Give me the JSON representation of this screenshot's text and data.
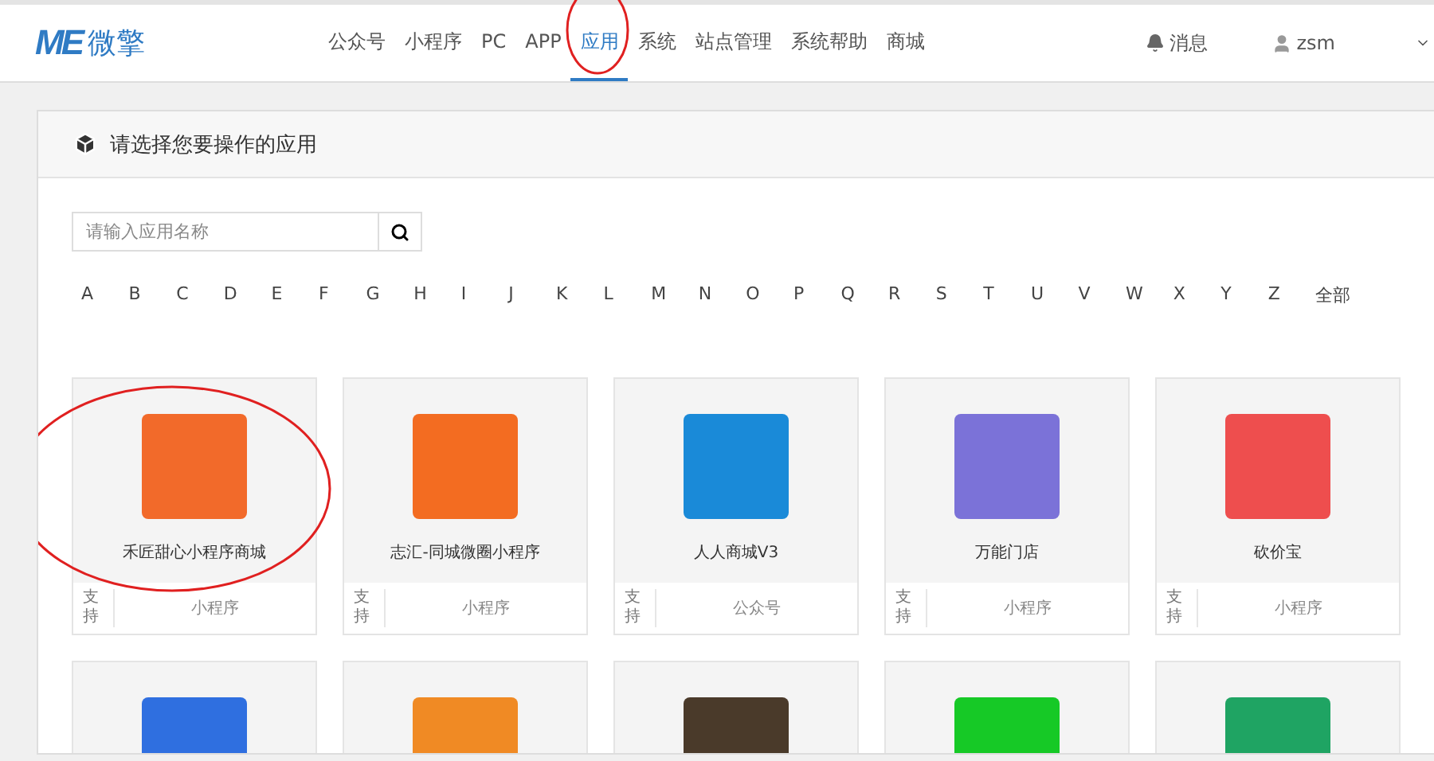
{
  "logo": {
    "mark": "ME",
    "name": "微擎"
  },
  "nav": [
    {
      "label": "公众号",
      "selected": false,
      "circled": false
    },
    {
      "label": "小程序",
      "selected": false,
      "circled": false
    },
    {
      "label": "PC",
      "selected": false,
      "circled": false
    },
    {
      "label": "APP",
      "selected": false,
      "circled": false
    },
    {
      "label": "应用",
      "selected": true,
      "circled": true
    },
    {
      "label": "系统",
      "selected": false,
      "circled": false
    },
    {
      "label": "站点管理",
      "selected": false,
      "circled": false
    },
    {
      "label": "系统帮助",
      "selected": false,
      "circled": false
    },
    {
      "label": "商城",
      "selected": false,
      "circled": false
    }
  ],
  "messages": "消息",
  "user": "zsm",
  "panel": {
    "title": "请选择您要操作的应用",
    "search": {
      "placeholder": "请输入应用名称"
    },
    "letters": [
      "A",
      "B",
      "C",
      "D",
      "E",
      "F",
      "G",
      "H",
      "I",
      "J",
      "K",
      "L",
      "M",
      "N",
      "O",
      "P",
      "Q",
      "R",
      "S",
      "T",
      "U",
      "V",
      "W",
      "X",
      "Y",
      "Z",
      "全部"
    ]
  },
  "apps": [
    {
      "name": "禾匠甜心小程序商城",
      "support_label": "支持",
      "support": "小程序",
      "color": "#f26a2a",
      "circled": true
    },
    {
      "name": "志汇-同城微圈小程序",
      "support_label": "支持",
      "support": "小程序",
      "color": "#f36c21",
      "circled": false
    },
    {
      "name": "人人商城V3",
      "support_label": "支持",
      "support": "公众号",
      "color": "#1a8ad8",
      "circled": false
    },
    {
      "name": "万能门店",
      "support_label": "支持",
      "support": "小程序",
      "color": "#7b72d8",
      "circled": false
    },
    {
      "name": "砍价宝",
      "support_label": "支持",
      "support": "小程序",
      "color": "#ee4e4e",
      "circled": false
    },
    {
      "color": "#2f6fe0",
      "circled": false
    },
    {
      "color": "#f08a24",
      "circled": false
    },
    {
      "color": "#4a3a2a",
      "circled": false
    },
    {
      "color": "#16c926",
      "circled": false
    },
    {
      "color": "#1fa463",
      "circled": false
    }
  ]
}
